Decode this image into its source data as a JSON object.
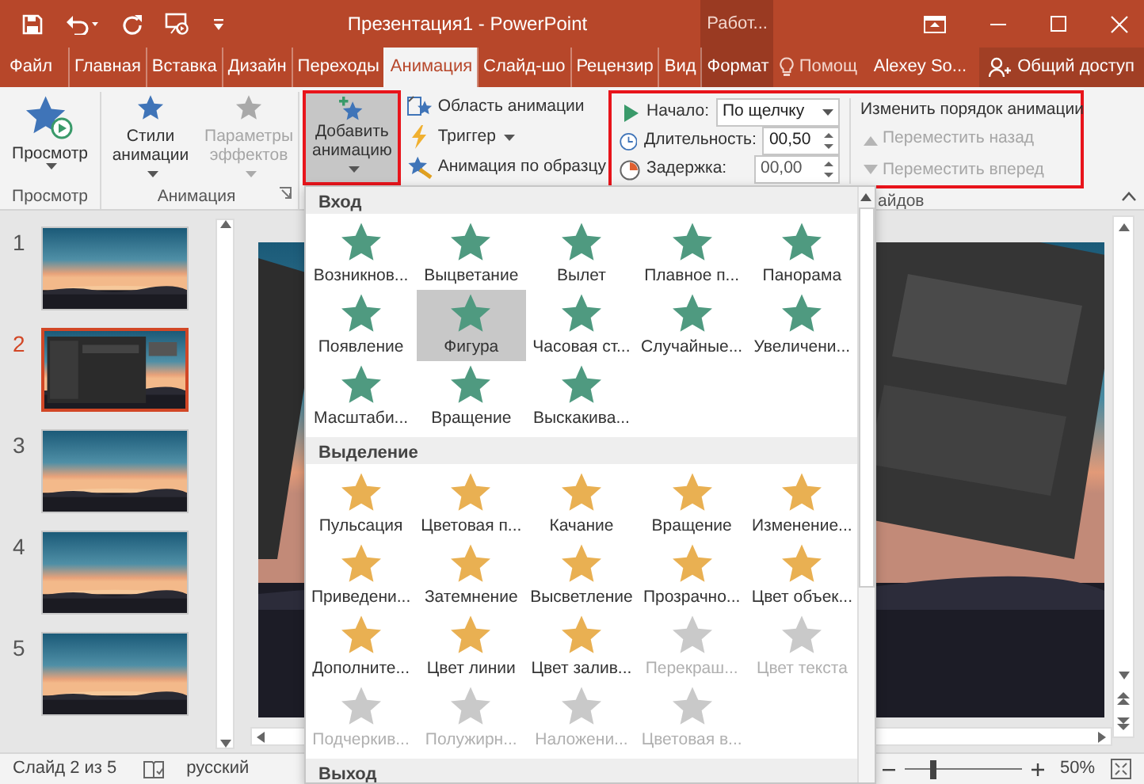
{
  "title_bar": {
    "title": "Презентация1 - PowerPoint",
    "context_label": "Работ..."
  },
  "ribbon_tabs": [
    {
      "label": "Файл",
      "kind": "file",
      "selected": false
    },
    {
      "label": "Главная",
      "kind": "tab",
      "selected": false
    },
    {
      "label": "Вставка",
      "kind": "tab",
      "selected": false
    },
    {
      "label": "Дизайн",
      "kind": "tab",
      "selected": false
    },
    {
      "label": "Переходы",
      "kind": "tab",
      "selected": false
    },
    {
      "label": "Анимация",
      "kind": "tab",
      "selected": true
    },
    {
      "label": "Слайд-шо",
      "kind": "tab",
      "selected": false
    },
    {
      "label": "Рецензир",
      "kind": "tab",
      "selected": false
    },
    {
      "label": "Вид",
      "kind": "tab",
      "selected": false
    },
    {
      "label": "Формат",
      "kind": "context",
      "selected": false
    }
  ],
  "tell_me": "Помощ",
  "user": "Alexey So...",
  "share": "Общий доступ",
  "ribbon": {
    "preview_group": {
      "button": "Просмотр",
      "label": "Просмотр"
    },
    "animation_group": {
      "label": "Анимация",
      "buttons": [
        {
          "label": "Стили анимации",
          "disabled": false
        },
        {
          "label": "Параметры эффектов",
          "disabled": true
        }
      ]
    },
    "add_animation": {
      "label": "Добавить анимацию",
      "selected": true
    },
    "advanced_buttons": [
      {
        "label": "Область анимации",
        "kind": "pane"
      },
      {
        "label": "Триггер",
        "kind": "trigger"
      },
      {
        "label": "Анимация по образцу",
        "kind": "painter"
      }
    ],
    "timing": {
      "start_label": "Начало:",
      "start_value": "По щелчку",
      "duration_label": "Длительность:",
      "duration_value": "00,50",
      "delay_label": "Задержка:",
      "delay_value": "00,00",
      "reorder_title": "Изменить порядок анимации",
      "reorder_buttons": [
        {
          "label": "Переместить назад",
          "disabled": true
        },
        {
          "label": "Переместить вперед",
          "disabled": true
        }
      ],
      "group_label": "айдов"
    }
  },
  "gallery": {
    "sections": [
      {
        "title": "Вход",
        "kind": "entrance",
        "items": [
          {
            "label": "Возникнов...",
            "selected": false,
            "disabled": false
          },
          {
            "label": "Выцветание",
            "selected": false,
            "disabled": false
          },
          {
            "label": "Вылет",
            "selected": false,
            "disabled": false
          },
          {
            "label": "Плавное п...",
            "selected": false,
            "disabled": false
          },
          {
            "label": "Панорама",
            "selected": false,
            "disabled": false
          },
          {
            "label": "Появление",
            "selected": false,
            "disabled": false
          },
          {
            "label": "Фигура",
            "selected": true,
            "disabled": false
          },
          {
            "label": "Часовая ст...",
            "selected": false,
            "disabled": false
          },
          {
            "label": "Случайные...",
            "selected": false,
            "disabled": false
          },
          {
            "label": "Увеличени...",
            "selected": false,
            "disabled": false
          },
          {
            "label": "Масштаби...",
            "selected": false,
            "disabled": false
          },
          {
            "label": "Вращение",
            "selected": false,
            "disabled": false
          },
          {
            "label": "Выскакива...",
            "selected": false,
            "disabled": false
          }
        ]
      },
      {
        "title": "Выделение",
        "kind": "emphasis",
        "items": [
          {
            "label": "Пульсация",
            "selected": false,
            "disabled": false
          },
          {
            "label": "Цветовая п...",
            "selected": false,
            "disabled": false
          },
          {
            "label": "Качание",
            "selected": false,
            "disabled": false
          },
          {
            "label": "Вращение",
            "selected": false,
            "disabled": false
          },
          {
            "label": "Изменение...",
            "selected": false,
            "disabled": false
          },
          {
            "label": "Приведени...",
            "selected": false,
            "disabled": false
          },
          {
            "label": "Затемнение",
            "selected": false,
            "disabled": false
          },
          {
            "label": "Высветление",
            "selected": false,
            "disabled": false
          },
          {
            "label": "Прозрачно...",
            "selected": false,
            "disabled": false
          },
          {
            "label": "Цвет объек...",
            "selected": false,
            "disabled": false
          },
          {
            "label": "Дополните...",
            "selected": false,
            "disabled": false
          },
          {
            "label": "Цвет линии",
            "selected": false,
            "disabled": false
          },
          {
            "label": "Цвет залив...",
            "selected": false,
            "disabled": false
          },
          {
            "label": "Перекраш...",
            "selected": false,
            "disabled": true
          },
          {
            "label": "Цвет текста",
            "selected": false,
            "disabled": true
          },
          {
            "label": "Подчеркив...",
            "selected": false,
            "disabled": true
          },
          {
            "label": "Полужирн...",
            "selected": false,
            "disabled": true
          },
          {
            "label": "Наложени...",
            "selected": false,
            "disabled": true
          },
          {
            "label": "Цветовая в...",
            "selected": false,
            "disabled": true
          }
        ]
      },
      {
        "title": "Выход",
        "kind": "exit"
      }
    ]
  },
  "slides": [
    {
      "number": "1",
      "selected": false
    },
    {
      "number": "2",
      "selected": true
    },
    {
      "number": "3",
      "selected": false
    },
    {
      "number": "4",
      "selected": false
    },
    {
      "number": "5",
      "selected": false
    }
  ],
  "status_bar": {
    "slide_info": "Слайд 2 из 5",
    "language": "русский",
    "zoom": "50%",
    "zoom_slider": {
      "level": 0.25
    }
  }
}
